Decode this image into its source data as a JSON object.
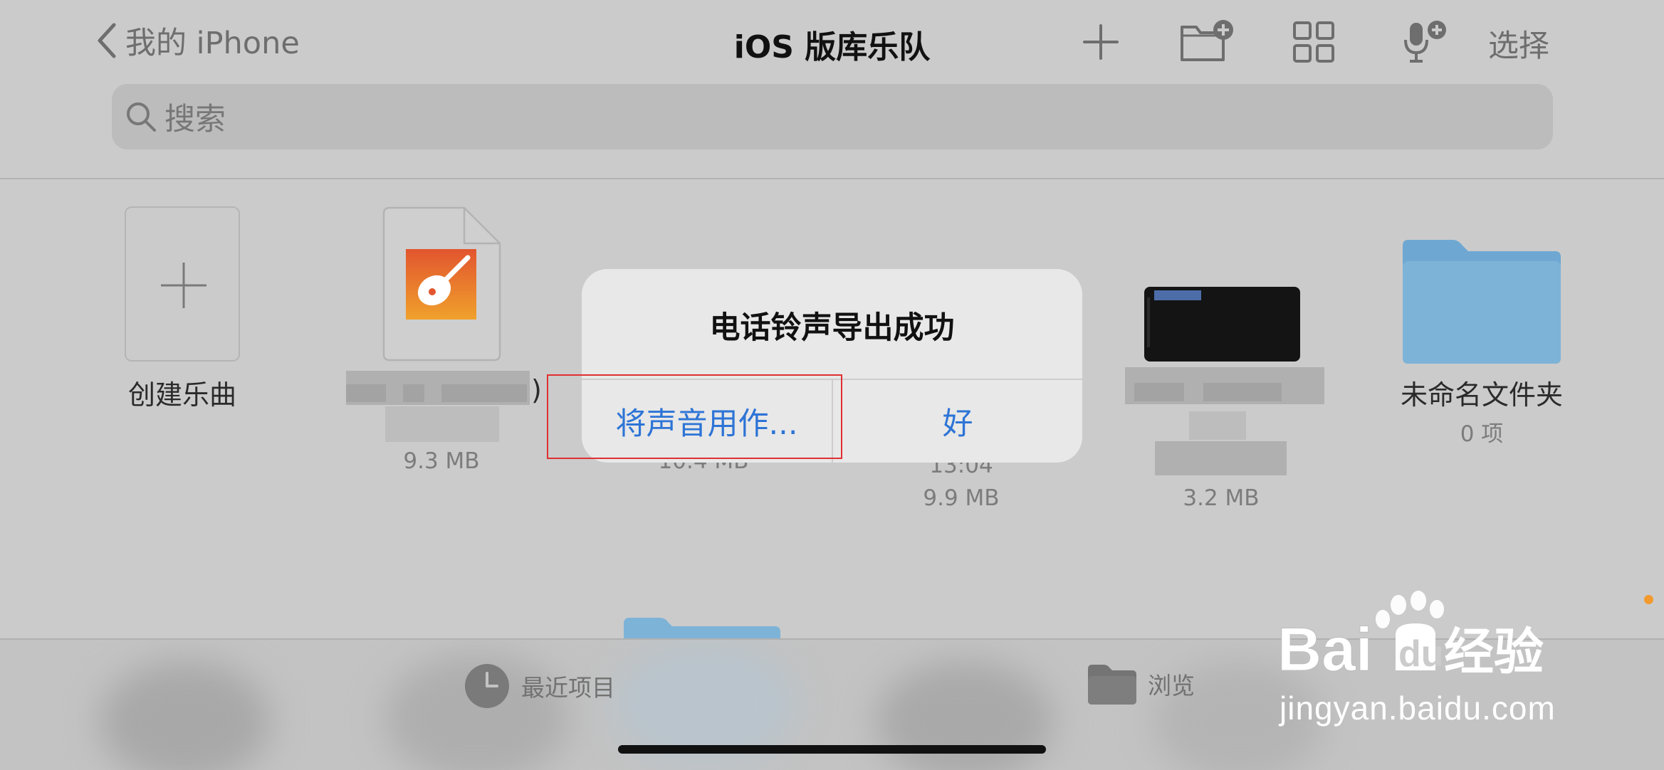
{
  "nav": {
    "back_label": "我的 iPhone",
    "title": "iOS 版库乐队",
    "select_label": "选择"
  },
  "search": {
    "placeholder": "搜索"
  },
  "files": {
    "create": {
      "label": "创建乐曲"
    },
    "item1": {
      "name_suffix": ")",
      "size": "9.3 MB"
    },
    "item2": {
      "size": "10.4 MB"
    },
    "item3": {
      "time": "13:04",
      "size": "9.9 MB"
    },
    "item4": {
      "size": "3.2 MB"
    },
    "folder": {
      "name": "未命名文件夹",
      "count": "0 项"
    }
  },
  "alert": {
    "title": "电话铃声导出成功",
    "use_sound_as": "将声音用作...",
    "ok": "好"
  },
  "tabbar": {
    "recent": "最近项目",
    "browse": "浏览"
  },
  "watermark": {
    "brand": "Baidu经验",
    "url": "jingyan.baidu.com"
  },
  "colors": {
    "accent_blue": "#2d74d6",
    "highlight_red": "#e03030",
    "folder_blue": "#7eb3d8",
    "indicator_orange": "#f29a2e"
  }
}
